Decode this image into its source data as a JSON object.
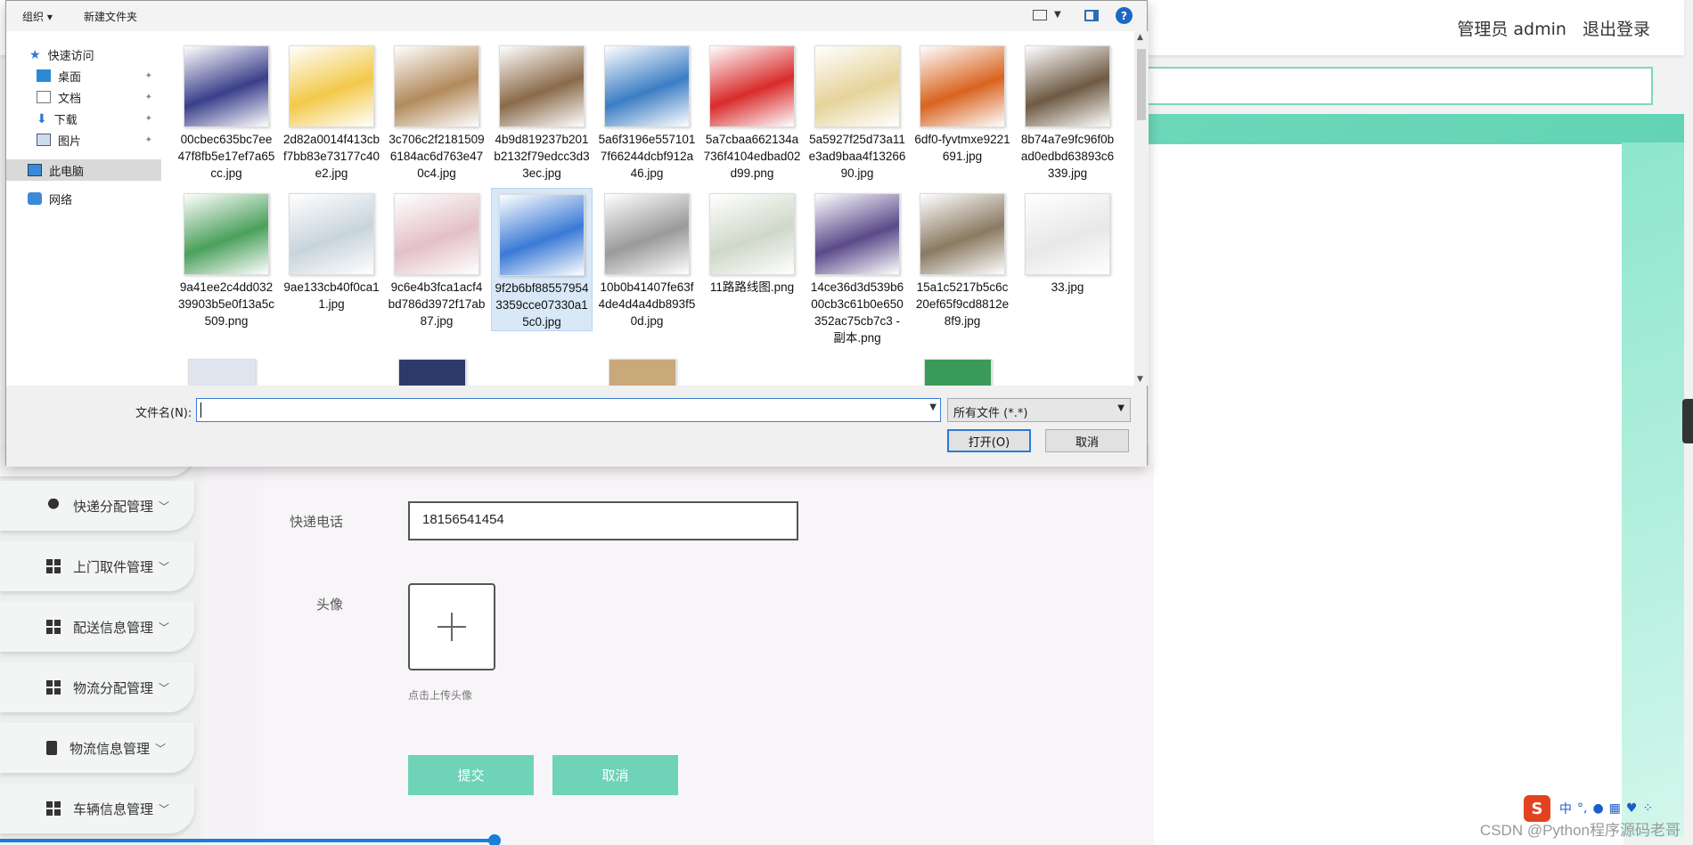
{
  "app": {
    "user_label": "管理员 admin",
    "logout_label": "退出登录",
    "sidebar": [
      {
        "label": "快递分配管理",
        "icon": "pin-icon"
      },
      {
        "label": "上门取件管理",
        "icon": "grid-icon"
      },
      {
        "label": "配送信息管理",
        "icon": "grid-icon"
      },
      {
        "label": "物流分配管理",
        "icon": "grid-icon"
      },
      {
        "label": "物流信息管理",
        "icon": "clipboard-icon"
      },
      {
        "label": "车辆信息管理",
        "icon": "grid-icon"
      }
    ],
    "form": {
      "phone_label": "快递电话",
      "phone_value": "18156541454",
      "avatar_label": "头像",
      "avatar_hint": "点击上传头像",
      "submit_label": "提交",
      "cancel_label": "取消"
    },
    "colors": {
      "accent": "#6ed3b7",
      "band": "#5fd3b1"
    }
  },
  "dialog": {
    "toolbar": {
      "organize": "组织 ▾",
      "new_folder": "新建文件夹",
      "help": "?"
    },
    "nav": {
      "quick_access": "快速访问",
      "items": [
        "桌面",
        "文档",
        "下载",
        "图片"
      ],
      "this_pc": "此电脑",
      "network": "网络"
    },
    "files_row1": [
      {
        "name": "00cbec635bc7ee47f8fb5e17ef7a65cc.jpg",
        "color": "#3a3f8a"
      },
      {
        "name": "2d82a0014f413cbf7bb83e73177c40e2.jpg",
        "color": "#f3c94a"
      },
      {
        "name": "3c706c2f21815096184ac6d763e470c4.jpg",
        "color": "#b28a5c"
      },
      {
        "name": "4b9d819237b201b2132f79edcc3d33ec.jpg",
        "color": "#8a6a4a"
      },
      {
        "name": "5a6f3196e5571017f66244dcbf912a46.jpg",
        "color": "#3b7dc4"
      },
      {
        "name": "5a7cbaa662134a736f4104edbad02d99.png",
        "color": "#d92b2b"
      },
      {
        "name": "5a5927f25d73a11e3ad9baa4f1326690.jpg",
        "color": "#e6d39a"
      },
      {
        "name": "6df0-fyvtmxe9221691.jpg",
        "color": "#d9631f"
      },
      {
        "name": "8b74a7e9fc96f0bad0edbd63893c6339.jpg",
        "color": "#6e5a44"
      }
    ],
    "files_row2": [
      {
        "name": "9a41ee2c4dd03239903b5e0f13a5c509.png",
        "color": "#4ba05b"
      },
      {
        "name": "9ae133cb40f0ca11.jpg",
        "color": "#c8d4dc"
      },
      {
        "name": "9c6e4b3fca1acf4bd786d3972f17ab87.jpg",
        "color": "#e3c0c7"
      },
      {
        "name": "9f2b6bf885579543359cce07330a15c0.jpg",
        "color": "#3a7ad6"
      },
      {
        "name": "10b0b41407fe63f4de4d4a4db893f50d.jpg",
        "color": "#9a9a9a"
      },
      {
        "name": "11路路线图.png",
        "color": "#cfd8c8"
      },
      {
        "name": "14ce36d3d539b600cb3c61b0e650352ac75cb7c3 - 副本.png",
        "color": "#5a4a8a"
      },
      {
        "name": "15a1c5217b5c6c20ef65f9cd8812e8f9.jpg",
        "color": "#8a7a62"
      },
      {
        "name": "33.jpg",
        "color": "#e8e8e8"
      }
    ],
    "filename_label": "文件名(N):",
    "filename_value": "",
    "filetype": "所有文件 (*.*)",
    "open_label": "打开(O)",
    "cancel_label": "取消"
  },
  "watermark": "CSDN @Python程序源码老哥",
  "ime": {
    "mode": "中"
  }
}
